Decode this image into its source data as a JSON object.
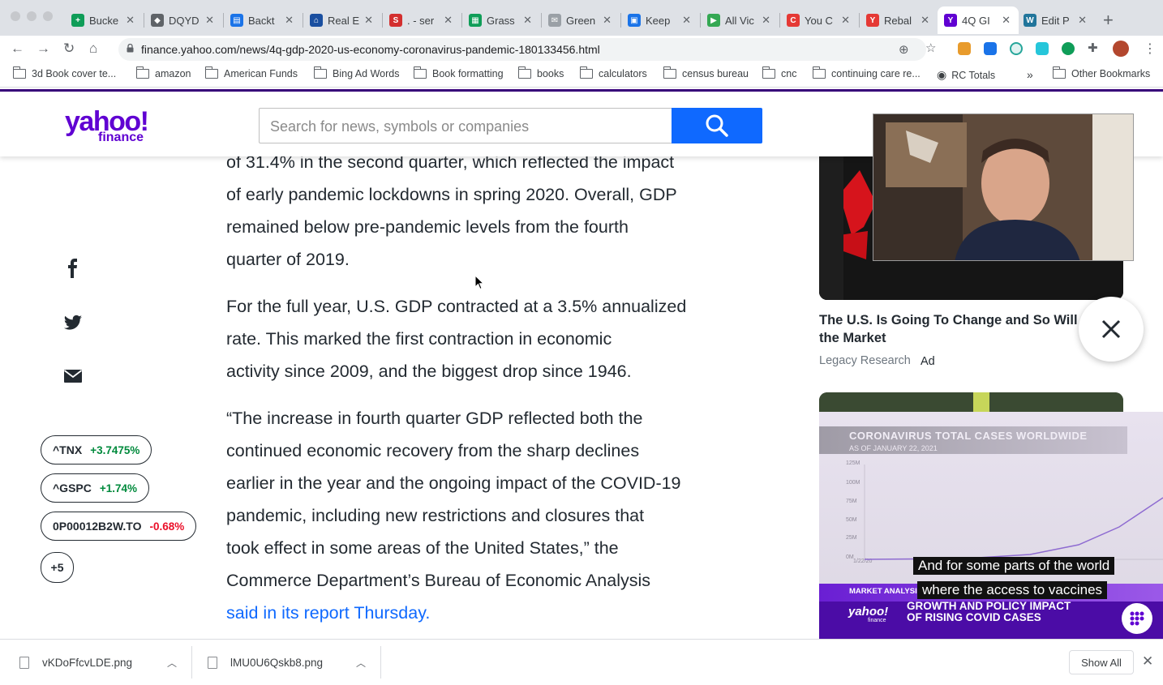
{
  "browser": {
    "tabs": [
      {
        "label": "Bucke",
        "color": "#0f9d58",
        "glyph": "+"
      },
      {
        "label": "DQYD",
        "color": "#5f6368",
        "glyph": "◆"
      },
      {
        "label": "Backt",
        "color": "#1a73e8",
        "glyph": "▤"
      },
      {
        "label": "Real E",
        "color": "#1a4fa0",
        "glyph": "⌂"
      },
      {
        "label": ". - ser",
        "color": "#d32f2f",
        "glyph": "S"
      },
      {
        "label": "Grass",
        "color": "#0f9d58",
        "glyph": "▦"
      },
      {
        "label": "Green",
        "color": "#9aa0a6",
        "glyph": "✉"
      },
      {
        "label": "Keep",
        "color": "#1a73e8",
        "glyph": "▣"
      },
      {
        "label": "All Vic",
        "color": "#34a853",
        "glyph": "▶"
      },
      {
        "label": "You C",
        "color": "#e53935",
        "glyph": "C"
      },
      {
        "label": "Rebal",
        "color": "#e53935",
        "glyph": "Y"
      },
      {
        "label": "4Q GI",
        "color": "#6001d2",
        "glyph": "Y"
      },
      {
        "label": "Edit P",
        "color": "#21759b",
        "glyph": "W"
      }
    ],
    "active_tab_index": 11,
    "url": "finance.yahoo.com/news/4q-gdp-2020-us-economy-coronavirus-pandemic-180133456.html",
    "bookmarks": [
      {
        "label": "3d Book cover te..."
      },
      {
        "label": "amazon"
      },
      {
        "label": "American Funds"
      },
      {
        "label": "Bing Ad Words"
      },
      {
        "label": "Book formatting"
      },
      {
        "label": "books"
      },
      {
        "label": "calculators"
      },
      {
        "label": "census bureau"
      },
      {
        "label": "cnc"
      },
      {
        "label": "continuing care re..."
      },
      {
        "label": "RC Totals"
      }
    ],
    "bookmarks_overflow": "»",
    "other_bookmarks": "Other Bookmarks"
  },
  "yahoo": {
    "logo_main": "yahoo!",
    "logo_sub": "finance",
    "search_placeholder": "Search for news, symbols or companies"
  },
  "article": {
    "paragraphs": [
      [
        "of 31.4% in the second quarter, which reflected the impact",
        "of early pandemic lockdowns in spring 2020. Overall, GDP",
        "remained below pre-pandemic levels from the fourth",
        "quarter of 2019."
      ],
      [
        "For the full year, U.S. GDP contracted at a 3.5% annualized",
        "rate. This marked the first contraction in economic",
        "activity since 2009, and the biggest drop since 1946."
      ],
      [
        "“The increase in fourth quarter GDP reflected both the",
        "continued economic recovery from the sharp declines",
        "earlier in the year and the ongoing impact of the COVID-19",
        "pandemic, including new restrictions and closures that",
        "took effect in some areas of the United States,” the",
        "Commerce Department’s Bureau of Economic Analysis"
      ]
    ],
    "link_text": "said in its report Thursday."
  },
  "tickers": [
    {
      "symbol": "^TNX",
      "change": "+3.7475%",
      "direction": "up"
    },
    {
      "symbol": "^GSPC",
      "change": "+1.74%",
      "direction": "up"
    },
    {
      "symbol": "0P00012B2W.TO",
      "change": "-0.68%",
      "direction": "down"
    }
  ],
  "tickers_more": "+5",
  "ad": {
    "title": "The U.S. Is Going To Change and So Will the Market",
    "source": "Legacy Research",
    "tag": "Ad"
  },
  "video": {
    "title": "CORONAVIRUS TOTAL CASES WORLDWIDE",
    "date": "AS OF JANUARY 22, 2021",
    "caption_lines": [
      "And for some parts of the world",
      "where the access to vaccines"
    ],
    "band_label": "MARKET ANALYSIS",
    "logo": "yahoo!",
    "logo_sub": "finance",
    "headline_lines": [
      "GROWTH AND POLICY IMPACT",
      "OF RISING COVID CASES"
    ],
    "axis_labels": [
      "125M",
      "100M",
      "75M",
      "50M",
      "25M",
      "0M",
      "1/22/20"
    ]
  },
  "downloads": [
    {
      "filename": "vKDoFfcvLDE.png"
    },
    {
      "filename": "lMU0U6Qskb8.png"
    }
  ],
  "downloads_show_all": "Show All",
  "colors": {
    "yahoo_purple": "#6001d2",
    "search_blue": "#0f69ff",
    "positive": "#008a3c",
    "negative": "#eb0f29"
  }
}
